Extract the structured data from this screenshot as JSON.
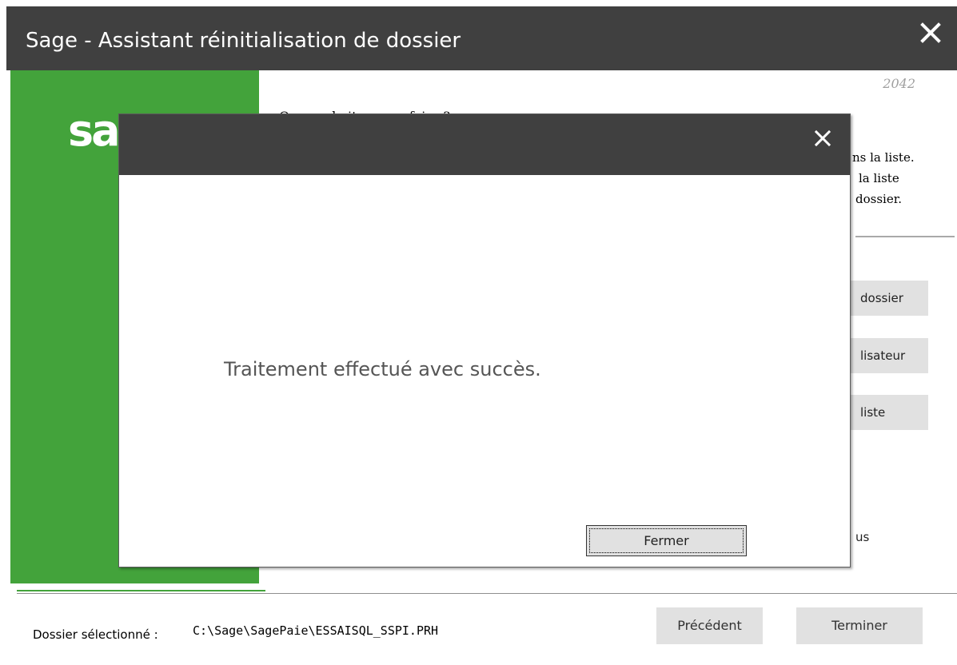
{
  "window": {
    "title": "Sage - Assistant réinitialisation de dossier",
    "close_icon": "close-icon"
  },
  "logo": {
    "text": "sage"
  },
  "version": "2042",
  "wizard": {
    "question": "Que souhaitez vous faire ?",
    "description_fragments": [
      "ns la liste.",
      "la liste",
      "dossier."
    ],
    "side_buttons": [
      "dossier",
      "lisateur",
      "liste"
    ],
    "partial_text": "us"
  },
  "footer": {
    "selected_label": "Dossier sélectionné :",
    "selected_path": "C:\\Sage\\SagePaie\\ESSAISQL_SSPI.PRH",
    "prev_button": "Précédent",
    "finish_button": "Terminer"
  },
  "dialog": {
    "message": "Traitement effectué avec succès.",
    "close_button": "Fermer"
  },
  "colors": {
    "titlebar": "#404040",
    "sage_green": "#43a33b",
    "button_bg": "#e1e1e1"
  }
}
